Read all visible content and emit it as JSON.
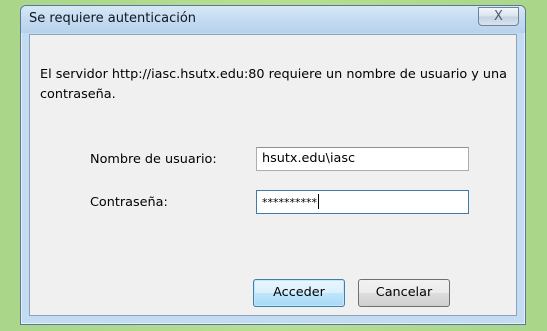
{
  "dialog": {
    "title": "Se requiere autenticación",
    "close_glyph": "X",
    "message": "El servidor http://iasc.hsutx.edu:80 requiere un nombre de usuario y una contraseña.",
    "username_label": "Nombre de usuario:",
    "username_value": "hsutx.edu\\iasc",
    "password_label": "Contraseña:",
    "password_mask": "**********",
    "accept_label": "Acceder",
    "cancel_label": "Cancelar"
  }
}
